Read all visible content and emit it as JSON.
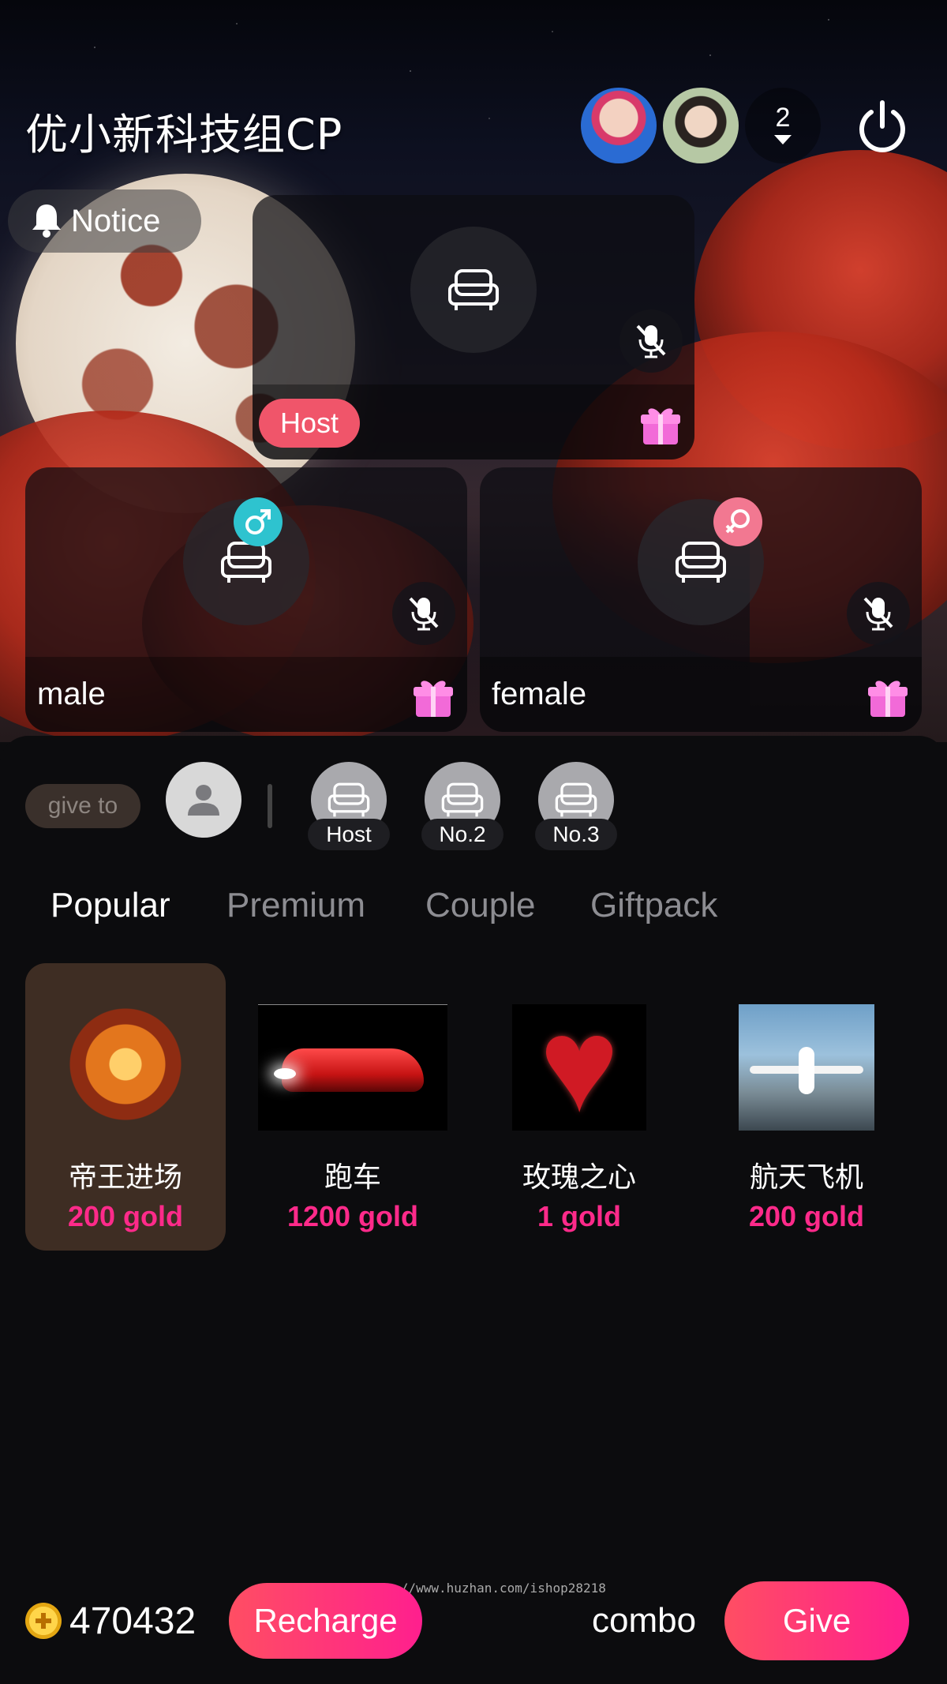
{
  "room": {
    "title": "优小新科技组CP",
    "online_count": "2"
  },
  "notice": {
    "label": "Notice"
  },
  "seats": {
    "host": {
      "tag": "Host"
    },
    "male": {
      "name": "male"
    },
    "female": {
      "name": "female"
    }
  },
  "give_panel": {
    "give_to_label": "give to",
    "recipients": [
      "Host",
      "No.2",
      "No.3"
    ]
  },
  "tabs": [
    "Popular",
    "Premium",
    "Couple",
    "Giftpack"
  ],
  "active_tab": "Popular",
  "gifts": [
    {
      "name": "帝王进场",
      "price": "200 gold",
      "selected": true
    },
    {
      "name": "跑车",
      "price": "1200 gold",
      "selected": false
    },
    {
      "name": "玫瑰之心",
      "price": "1 gold",
      "selected": false
    },
    {
      "name": "航天飞机",
      "price": "200 gold",
      "selected": false
    }
  ],
  "footer": {
    "balance": "470432",
    "recharge_label": "Recharge",
    "combo_label": "combo",
    "give_label": "Give",
    "watermark": "https://www.huzhan.com/ishop28218"
  },
  "colors": {
    "accent_pink": "#ff2a8a",
    "host_tag": "#f0556a",
    "male": "#2ec3cf",
    "female": "#f27891",
    "selected_card": "#3e2d23"
  },
  "icons": {
    "seat": "sofa-icon",
    "mic": "mic-muted-icon",
    "gift": "gift-box-icon",
    "notice": "bell-icon",
    "power": "power-icon",
    "male": "male-symbol-icon",
    "female": "female-symbol-icon",
    "coin": "gold-coin-icon",
    "all": "person-icon"
  }
}
